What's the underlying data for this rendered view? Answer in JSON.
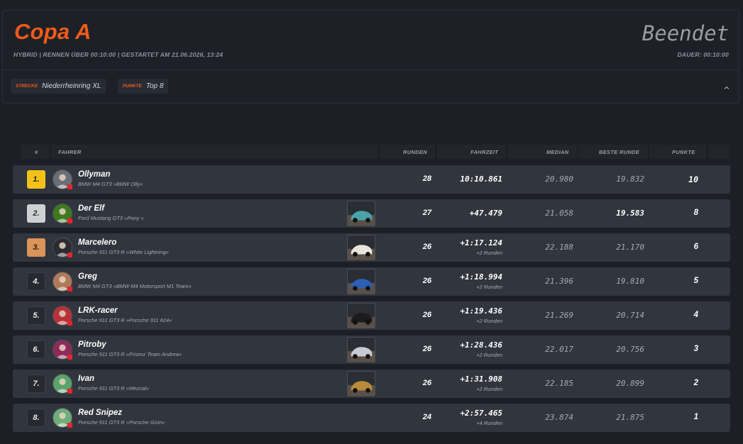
{
  "race": {
    "title": "Copa A",
    "meta": "HYBRID | RENNEN ÜBER 00:10:00 | GESTARTET AM 21.06.2026, 13:24",
    "status": "Beendet",
    "duration": "DAUER: 00:10:00",
    "chips": [
      {
        "key": "STRECKE",
        "value": "Niederrheinring XL"
      },
      {
        "key": "PUNKTE",
        "value": "Top 8"
      }
    ]
  },
  "table": {
    "headers": {
      "pos": "#",
      "driver": "FAHRER",
      "laps": "RUNDEN",
      "time": "FAHRZEIT",
      "median": "MEDIAN",
      "best": "BESTE RUNDE",
      "points": "PUNKTE"
    },
    "rows": [
      {
        "pos": "1.",
        "name": "Ollyman",
        "car": "BMW M4 GT3 »BMW Olly«",
        "laps": "28",
        "time": "10:10.861",
        "sub": "",
        "median": "20.980",
        "best": "19.832",
        "points": "10",
        "badge": "gold",
        "avatar": "#6b6f75",
        "thumb": null
      },
      {
        "pos": "2.",
        "name": "Der Elf",
        "car": "Ford Mustang GT3 »Pony «",
        "laps": "27",
        "time": "+47.479",
        "sub": "",
        "median": "21.058",
        "best": "19.583",
        "points": "8",
        "badge": "silver",
        "avatar": "#3d7a1d",
        "thumb": "#4aa3a8"
      },
      {
        "pos": "3.",
        "name": "Marcelero",
        "car": "Porsche 911 GT3 R »White Lightning«",
        "laps": "26",
        "time": "+1:17.124",
        "sub": "+2 Runden",
        "median": "22.188",
        "best": "21.170",
        "points": "6",
        "badge": "bronze",
        "avatar": "#2a2c30",
        "thumb": "#e9e4dc"
      },
      {
        "pos": "4.",
        "name": "Greg",
        "car": "BMW M4 GT3 »BMW M4 Motorsport M1 Team«",
        "laps": "26",
        "time": "+1:18.994",
        "sub": "+2 Runden",
        "median": "21.396",
        "best": "19.810",
        "points": "5",
        "badge": "plain",
        "avatar": "#b07a5a",
        "thumb": "#2d5fb5"
      },
      {
        "pos": "5.",
        "name": "LRK-racer",
        "car": "Porsche 911 GT3 R »Porsche 911 #24«",
        "laps": "26",
        "time": "+1:19.436",
        "sub": "+2 Runden",
        "median": "21.269",
        "best": "20.714",
        "points": "4",
        "badge": "plain",
        "avatar": "#b8323a",
        "thumb": "#1b1b1d"
      },
      {
        "pos": "6.",
        "name": "Pitroby",
        "car": "Porsche 911 GT3 R »Friseur Team Andrea«",
        "laps": "26",
        "time": "+1:28.436",
        "sub": "+2 Runden",
        "median": "22.017",
        "best": "20.756",
        "points": "3",
        "badge": "plain",
        "avatar": "#8e2a5a",
        "thumb": "#c9c9d4"
      },
      {
        "pos": "7.",
        "name": "Ivan",
        "car": "Porsche 911 GT3 R »Mezcal«",
        "laps": "26",
        "time": "+1:31.908",
        "sub": "+2 Runden",
        "median": "22.185",
        "best": "20.899",
        "points": "2",
        "badge": "plain",
        "avatar": "#5aa36a",
        "thumb": "#b88a3a"
      },
      {
        "pos": "8.",
        "name": "Red Snipez",
        "car": "Porsche 911 GT3 R »Porsche Grün«",
        "laps": "24",
        "time": "+2:57.465",
        "sub": "+4 Runden",
        "median": "23.874",
        "best": "21.875",
        "points": "1",
        "badge": "plain",
        "avatar": "#6fae7a",
        "thumb": null
      }
    ]
  },
  "icons": {
    "collapse": "chevron-up-icon"
  },
  "colors": {
    "accent": "#f05a1a",
    "gold": "#f2c21b",
    "silver": "#cfd0d2",
    "bronze": "#d9955a"
  }
}
